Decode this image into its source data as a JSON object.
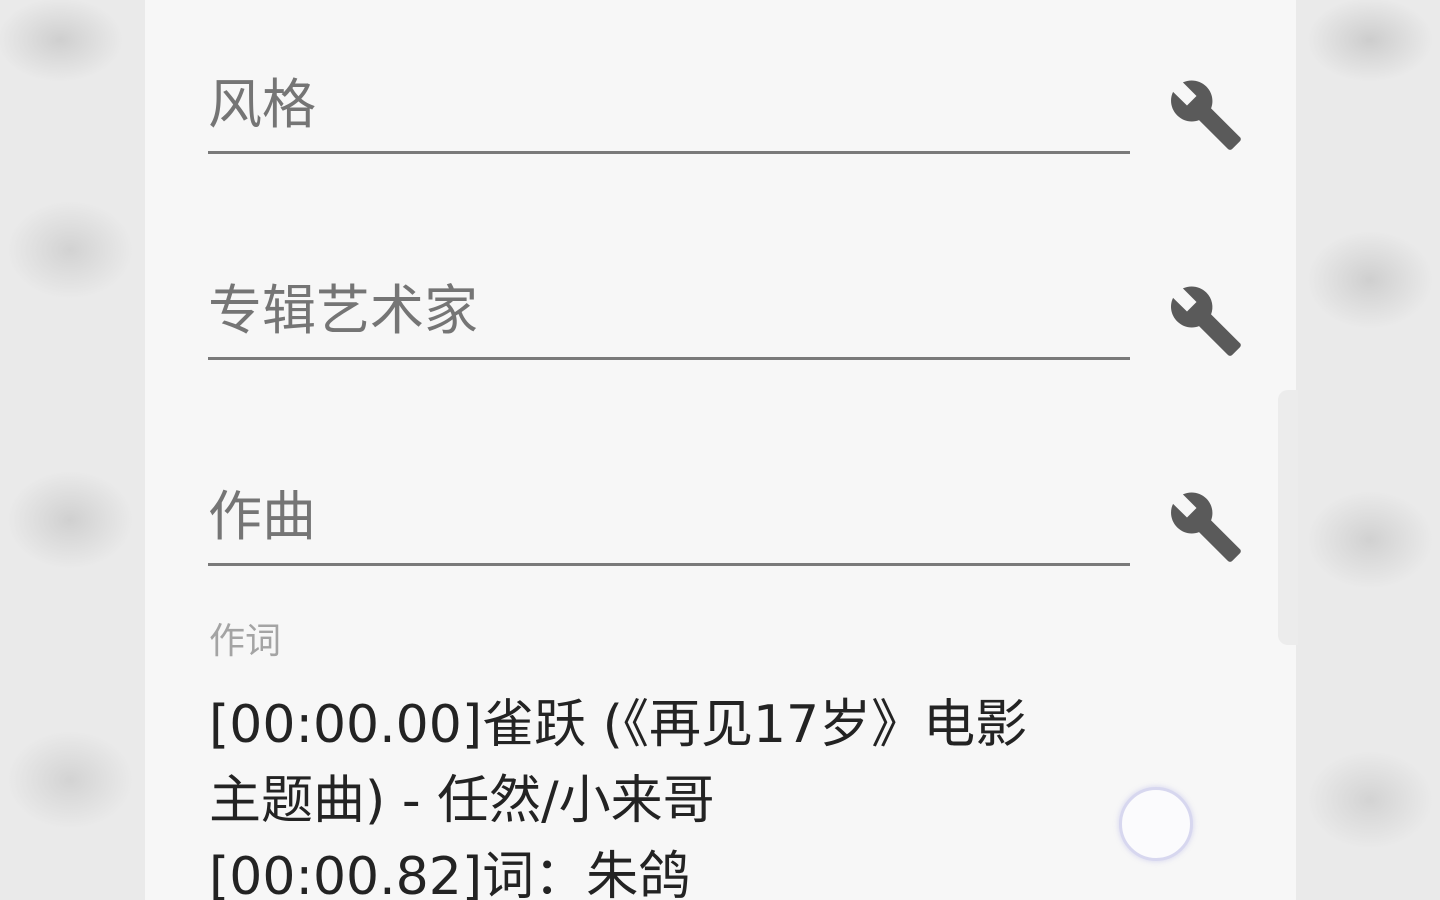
{
  "fields": [
    {
      "id": "genre",
      "placeholder": "风格",
      "value": ""
    },
    {
      "id": "album_artist",
      "placeholder": "专辑艺术家",
      "value": ""
    },
    {
      "id": "composer",
      "placeholder": "作曲",
      "value": ""
    }
  ],
  "lyrics": {
    "label": "作词",
    "text": "[00:00.00]雀跃 (《再见17岁》电影\n主题曲) - 任然/小来哥\n[00:00.82]词：朱鸽"
  },
  "icons": {
    "field_action": "wrench-icon"
  }
}
